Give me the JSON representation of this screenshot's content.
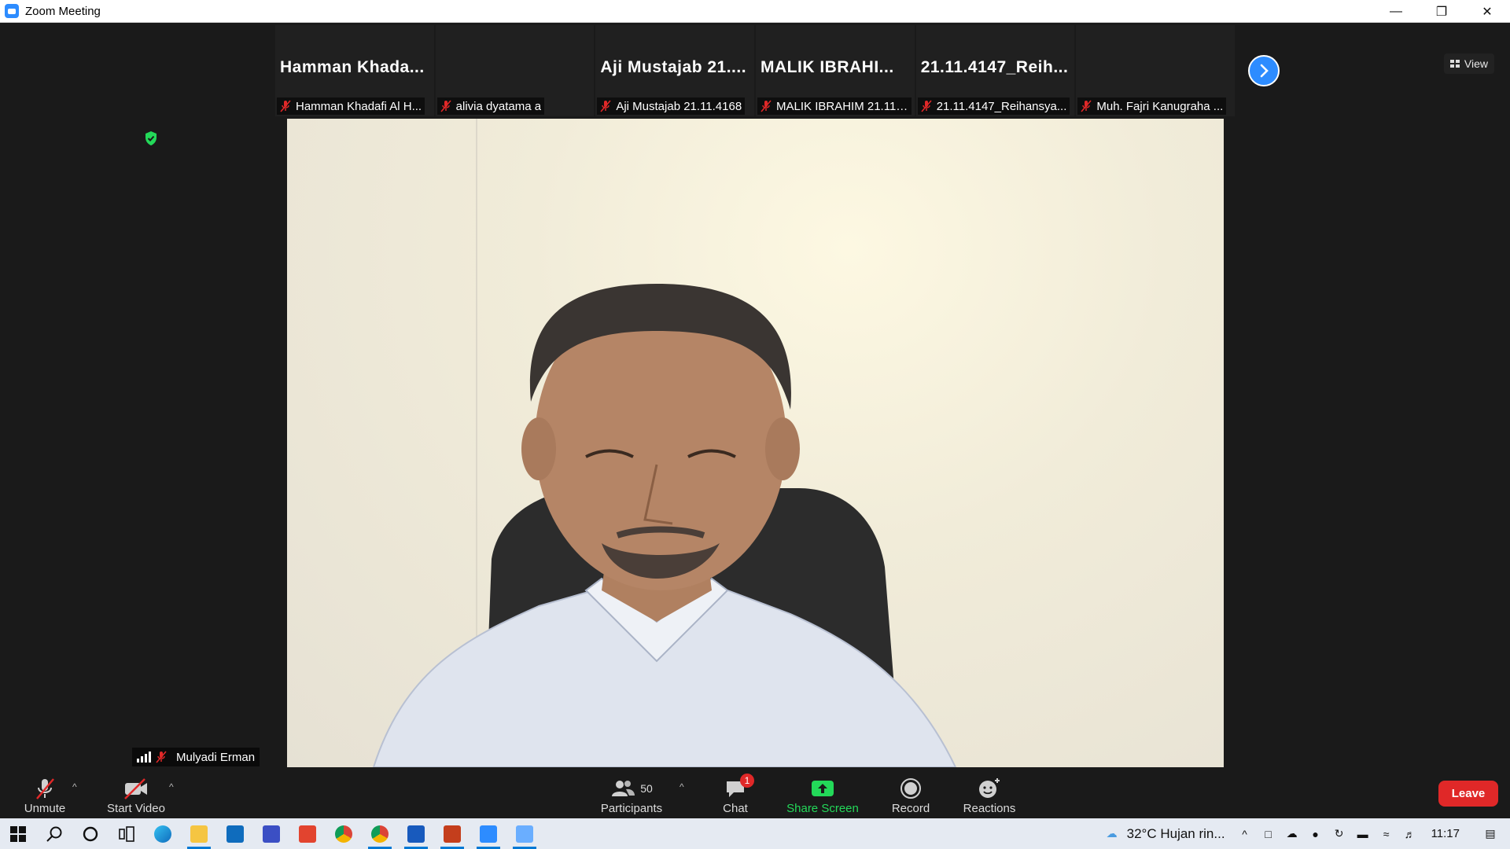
{
  "window": {
    "title": "Zoom Meeting"
  },
  "view_button": {
    "label": "View"
  },
  "thumbnails": [
    {
      "big": "Hamman  Khada...",
      "small": "Hamman Khadafi Al H..."
    },
    {
      "big": "",
      "small": "alivia dyatama a"
    },
    {
      "big": "Aji  Mustajab  21....",
      "small": "Aji Mustajab 21.11.4168"
    },
    {
      "big": "MALIK  IBRAHI...",
      "small": "MALIK IBRAHIM 21.11...."
    },
    {
      "big": "21.11.4147_Reih...",
      "small": "21.11.4147_Reihansya..."
    },
    {
      "big": "",
      "small": "Muh. Fajri Kanugraha ..."
    }
  ],
  "active_speaker": {
    "name": "Mulyadi Erman"
  },
  "toolbar": {
    "unmute": "Unmute",
    "start_video": "Start Video",
    "participants": "Participants",
    "participants_count": "50",
    "chat": "Chat",
    "chat_badge": "1",
    "share_screen": "Share Screen",
    "record": "Record",
    "reactions": "Reactions",
    "leave": "Leave"
  },
  "taskbar": {
    "weather": "32°C  Hujan rin...",
    "time": "11:17"
  },
  "colors": {
    "accent": "#2d8cff",
    "leave": "#e02828",
    "share": "#23d959",
    "muted": "#e02828"
  }
}
